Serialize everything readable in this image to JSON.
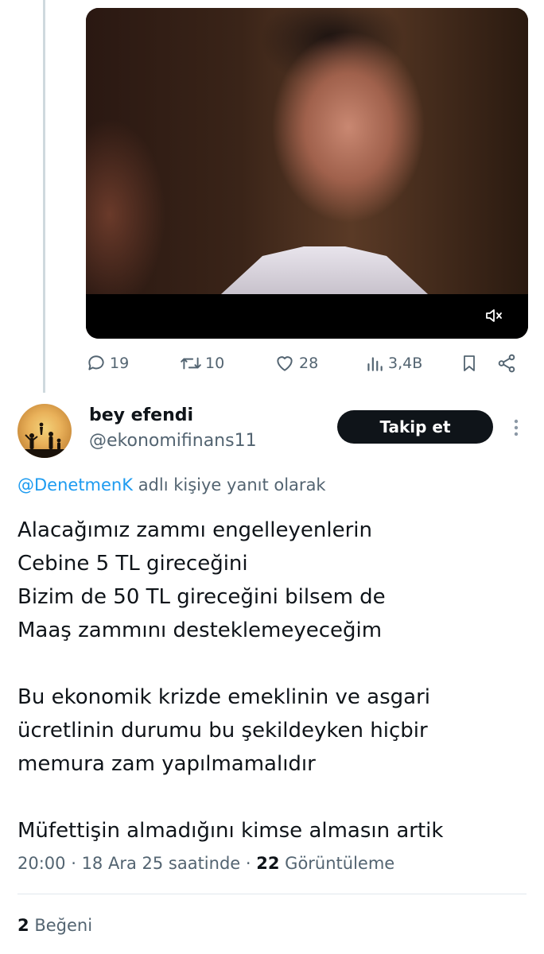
{
  "previous_tweet": {
    "media": {
      "type": "video",
      "muted": true,
      "icon": "volume-mute-icon"
    },
    "actions": {
      "replies": "19",
      "retweets": "10",
      "likes": "28",
      "views": "3,4B"
    }
  },
  "tweet": {
    "author": {
      "display_name": "bey efendi",
      "handle": "@ekonomifinans11"
    },
    "follow_label": "Takip et",
    "reply_to": {
      "mention": "@DenetmenK",
      "suffix": " adlı kişiye yanıt olarak"
    },
    "text_lines": [
      "Alacağımız zammı engelleyenlerin",
      "Cebine 5 TL gireceğini",
      "Bizim de 50 TL gireceğini bilsem de",
      "Maaş zammını desteklemeyeceğim",
      "",
      "Bu ekonomik krizde emeklinin ve asgari",
      "ücretlinin durumu bu şekildeyken hiçbir",
      "memura zam yapılmamalıdır",
      "",
      "Müfettişin almadığını kimse almasın artik"
    ],
    "meta": {
      "time": "20:00",
      "date": "18 Ara 25 saatinde",
      "views_count": "22",
      "views_label": "Görüntüleme",
      "separator": " · "
    },
    "likes": {
      "count": "2",
      "label": "Beğeni"
    }
  },
  "colors": {
    "primary_text": "#0f1419",
    "secondary_text": "#536471",
    "link": "#1d9bf0",
    "follow_button_bg": "#0f1419",
    "thread_line": "#cfd9de"
  }
}
